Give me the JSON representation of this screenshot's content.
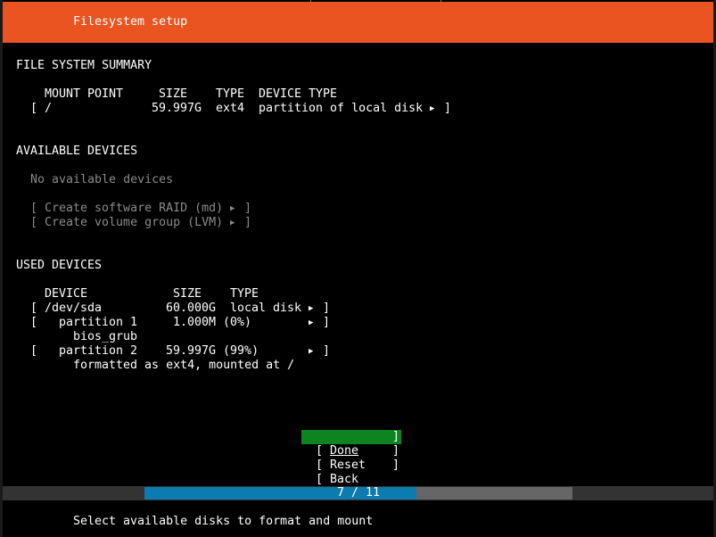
{
  "header": {
    "title": "Filesystem setup",
    "color": "#e95420"
  },
  "fs_summary": {
    "heading": "FILE SYSTEM SUMMARY",
    "col_mount": "MOUNT POINT",
    "col_size": "SIZE",
    "col_type": "TYPE",
    "col_devtype": "DEVICE TYPE",
    "rows": [
      {
        "mount": "/",
        "size": "59.997G",
        "type": "ext4",
        "device_type": "partition of local disk"
      }
    ]
  },
  "available": {
    "heading": "AVAILABLE DEVICES",
    "empty": "No available devices",
    "raid": "Create software RAID (md)",
    "lvm": "Create volume group (LVM)"
  },
  "used": {
    "heading": "USED DEVICES",
    "col_device": "DEVICE",
    "col_size": "SIZE",
    "col_type": "TYPE",
    "rows": [
      {
        "device": "/dev/sda",
        "size": "60.000G",
        "type": "local disk"
      },
      {
        "device": "partition 1",
        "size": "1.000M (0%)",
        "detail": "bios_grub"
      },
      {
        "device": "partition 2",
        "size": "59.997G (99%)",
        "detail": "formatted as ext4, mounted at /"
      }
    ]
  },
  "buttons": {
    "done": "Done",
    "reset": "Reset",
    "back": "Back",
    "focus_color": "#0e8420"
  },
  "progress": {
    "label": "7 / 11",
    "current": 7,
    "total": 11,
    "fill_color": "#0c7bb0"
  },
  "help_text": "Select available disks to format and mount",
  "glyphs": {
    "arrow": "▶",
    "lb": "[",
    "rb": "]"
  }
}
